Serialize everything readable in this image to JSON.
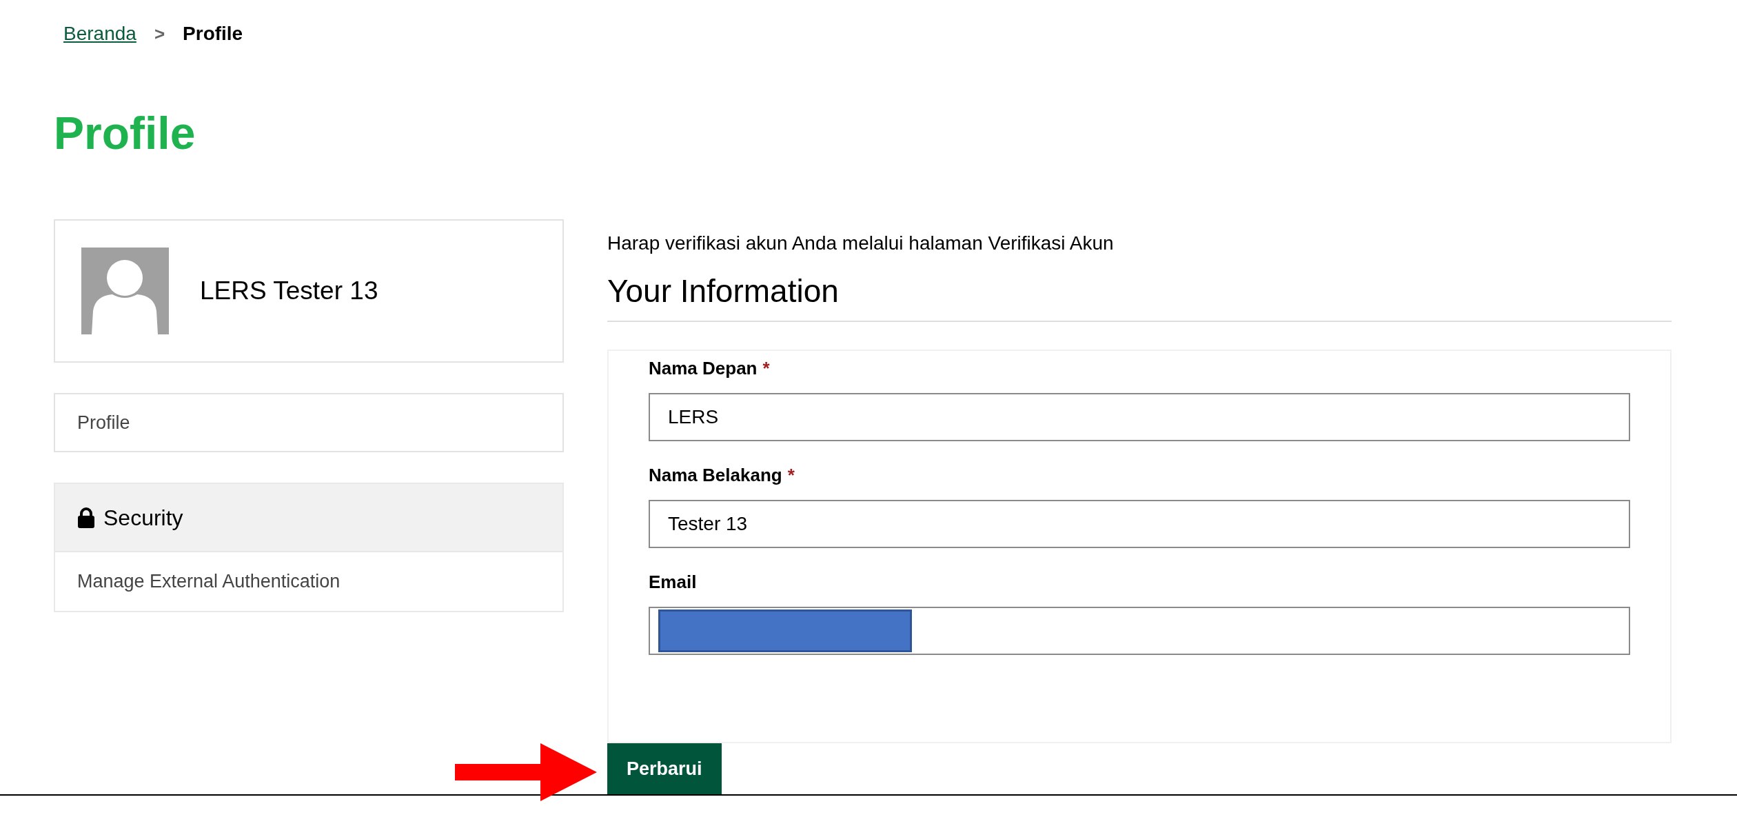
{
  "breadcrumb": [
    {
      "kind": "link",
      "label": "Beranda"
    },
    {
      "kind": "separator",
      "label": ">"
    },
    {
      "kind": "current",
      "label": "Profile"
    }
  ],
  "page_title": "Profile",
  "user_card": {
    "name": "LERS Tester 13"
  },
  "sidebar": [
    {
      "kind": "item",
      "label": "Profile"
    },
    {
      "kind": "section",
      "label": "Security",
      "children": [
        {
          "label": "Manage External Authentication"
        }
      ]
    }
  ],
  "notice": "Harap verifikasi akun Anda melalui halaman Verifikasi Akun",
  "section_title": "Your Information",
  "fields": [
    {
      "label": "Nama Depan",
      "required_mark": "*",
      "value": "LERS"
    },
    {
      "label": "Nama Belakang",
      "required_mark": "*",
      "value": "Tester 13"
    },
    {
      "label": "Email",
      "redacted": true
    }
  ],
  "submit_button": "Perbarui"
}
